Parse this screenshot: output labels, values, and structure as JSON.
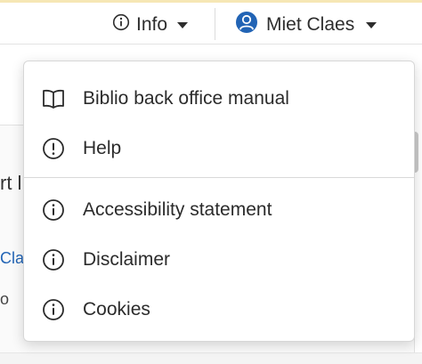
{
  "navbar": {
    "info_label": "Info",
    "user_label": "Miet Claes"
  },
  "background": {
    "partial_text_1": "rt l",
    "partial_text_2": "Cla",
    "partial_text_3": "o"
  },
  "info_menu": {
    "items": [
      {
        "label": "Biblio back office manual",
        "icon": "book-icon"
      },
      {
        "label": "Help",
        "icon": "exclamation-circle-icon"
      },
      {
        "label": "Accessibility statement",
        "icon": "info-circle-icon"
      },
      {
        "label": "Disclaimer",
        "icon": "info-circle-icon"
      },
      {
        "label": "Cookies",
        "icon": "info-circle-icon"
      }
    ]
  },
  "colors": {
    "accent_top_border": "#f6e7b5",
    "user_avatar": "#2264b5",
    "link_blue": "#2264b5"
  }
}
